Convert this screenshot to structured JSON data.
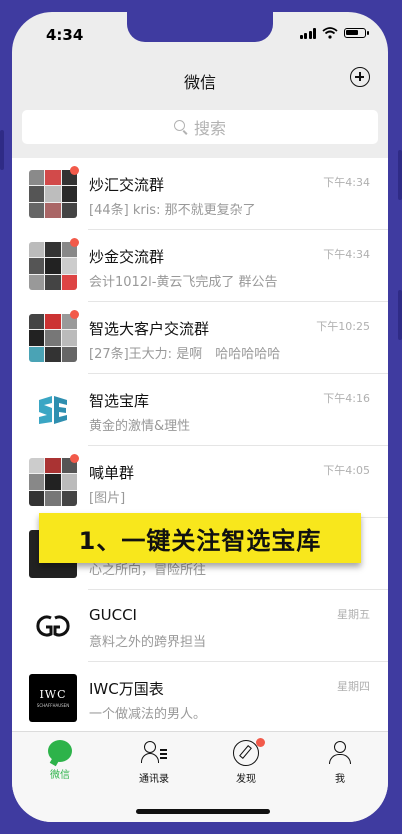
{
  "status": {
    "time": "4:34"
  },
  "nav": {
    "title": "微信"
  },
  "search": {
    "placeholder": "搜索"
  },
  "chats": [
    {
      "name": "炒汇交流群",
      "preview": "[44条] kris: 那不就更复杂了",
      "time": "下午4:34",
      "unread": true,
      "avatar": "group-grid"
    },
    {
      "name": "炒金交流群",
      "preview": "会计1012l-黄云飞完成了 群公告",
      "time": "下午4:34",
      "unread": true,
      "avatar": "group-grid"
    },
    {
      "name": "智选大客户交流群",
      "preview": "[27条]王大力: 是啊　哈哈哈哈哈",
      "time": "下午10:25",
      "unread": true,
      "avatar": "group-grid"
    },
    {
      "name": "智选宝库",
      "preview": "黄金的激情&理性",
      "time": "下午4:16",
      "unread": false,
      "avatar": "SE-logo"
    },
    {
      "name": "喊单群",
      "preview": "[图片]",
      "time": "下午4:05",
      "unread": true,
      "avatar": "group-grid"
    },
    {
      "name": "",
      "preview": "心之所向，冒险所往",
      "time": "",
      "unread": false,
      "avatar": "dark"
    },
    {
      "name": "GUCCI",
      "preview": "意料之外的跨界担当",
      "time": "星期五",
      "unread": false,
      "avatar": "GUCCI-logo"
    },
    {
      "name": "IWC万国表",
      "preview": "一个做减法的男人。",
      "time": "星期四",
      "unread": false,
      "avatar": "IWC-logo"
    }
  ],
  "iwc_logo": {
    "brand": "IWC",
    "subtext": "SCHAFFHAUSEN"
  },
  "banner": {
    "text": "1、一键关注智选宝库"
  },
  "tabs": [
    {
      "label": "微信",
      "icon": "chat-bubble-icon",
      "active": true
    },
    {
      "label": "通讯录",
      "icon": "contacts-icon",
      "active": false
    },
    {
      "label": "发现",
      "icon": "compass-icon",
      "active": false,
      "badge": true
    },
    {
      "label": "我",
      "icon": "person-icon",
      "active": false
    }
  ],
  "colors": {
    "accent": "#2db34a",
    "badge": "#f25a4a",
    "banner": "#f8e71c",
    "frame": "#3f3ba0"
  }
}
